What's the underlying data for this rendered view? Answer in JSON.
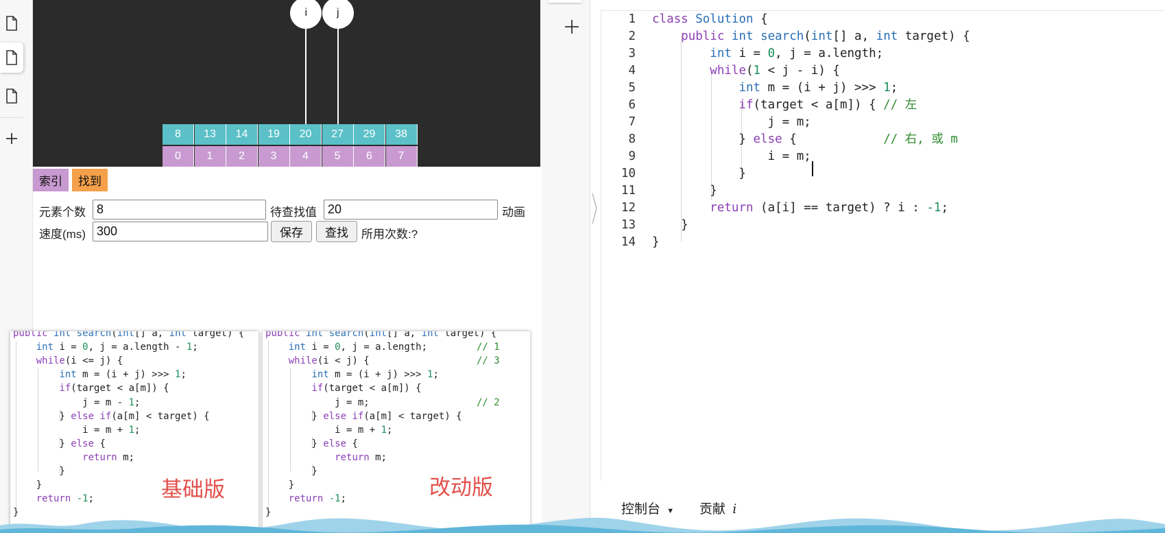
{
  "visualization": {
    "values": [
      "8",
      "13",
      "14",
      "19",
      "20",
      "27",
      "29",
      "38"
    ],
    "indices": [
      "0",
      "1",
      "2",
      "3",
      "4",
      "5",
      "6",
      "7"
    ],
    "pointers": [
      {
        "label": "i",
        "index": 4
      },
      {
        "label": "j",
        "index": 5
      }
    ],
    "colors": {
      "value_cell": "#5bc0c8",
      "index_cell": "#c89ad1",
      "background": "#2b2b2b"
    }
  },
  "legend": {
    "index_label": "索引",
    "found_label": "找到",
    "index_color": "#c89ad1",
    "found_color": "#f5a04a"
  },
  "controls": {
    "count_label": "元素个数",
    "count_value": "8",
    "target_label": "待查找值",
    "target_value": "20",
    "animation_label": "动画",
    "speed_label": "速度(ms)",
    "speed_value": "300",
    "save_button": "保存",
    "search_button": "查找",
    "steps_label": "所用次数:?"
  },
  "panel_basic": {
    "label": "基础版",
    "lines": [
      "public int search(int[] a, int target) {",
      "    int i = 0, j = a.length - 1;",
      "    while(i <= j) {",
      "        int m = (i + j) >>> 1;",
      "        if(target < a[m]) {",
      "            j = m - 1;",
      "        } else if(a[m] < target) {",
      "            i = m + 1;",
      "        } else {",
      "            return m;",
      "        }",
      "    }",
      "    return -1;",
      "}"
    ]
  },
  "panel_modified": {
    "label": "改动版",
    "lines": [
      "public int search(int[] a, int target) {",
      "    int i = 0, j = a.length;",
      "    while(i < j) {",
      "        int m = (i + j) >>> 1;",
      "        if(target < a[m]) {",
      "            j = m;",
      "        } else if(a[m] < target) {",
      "            i = m + 1;",
      "        } else {",
      "            return m;",
      "        }",
      "    }",
      "    return -1;",
      "}"
    ],
    "comments": {
      "1": "// 1",
      "2": "// 3",
      "5": "// 2"
    }
  },
  "editor": {
    "lines": [
      "class Solution {",
      "    public int search(int[] a, int target) {",
      "        int i = 0, j = a.length;",
      "        while(1 < j - i) {",
      "            int m = (i + j) >>> 1;",
      "            if(target < a[m]) { // 左",
      "                j = m;",
      "            } else {            // 右, 或 m",
      "                i = m;",
      "            }",
      "        }",
      "        return (a[i] == target) ? i : -1;",
      "    }",
      "}"
    ],
    "line_numbers": [
      "1",
      "2",
      "3",
      "4",
      "5",
      "6",
      "7",
      "8",
      "9",
      "10",
      "11",
      "12",
      "13",
      "14"
    ],
    "active_line": 9
  },
  "console": {
    "console_label": "控制台",
    "contribute_label": "贡献"
  },
  "editor_sidebar": {
    "add_icon": "plus-icon"
  }
}
